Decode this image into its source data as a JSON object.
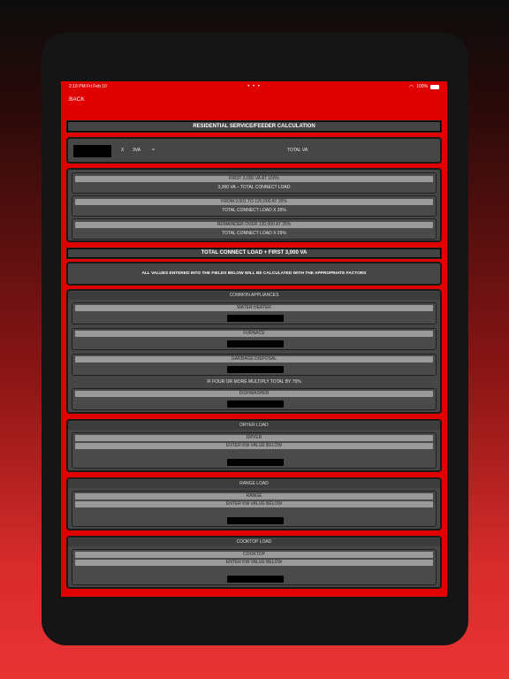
{
  "status": {
    "time": "2:19 PM   Fri Feb 10",
    "dots": "• • •",
    "battery": "100%"
  },
  "nav": {
    "back": "BACK"
  },
  "calc": {
    "title": "RESIDENTIAL SERVICE/FEEDER CALCULATION",
    "x": "X",
    "factor": "3VA",
    "equals": "=",
    "total_va": "TOTAL VA"
  },
  "tiers": {
    "t1_label": "FIRST 3,000 VA AT 100%",
    "t1_value": "3,000 VA – TOTAL CONNECT LOAD",
    "t2_label": "FROM 3,001 TO 120,000 AT 35%",
    "t2_value": "TOTAL CONNECT LOAD X 35%",
    "t3_label": "REMAINDER OVER 120,000 AT 25%",
    "t3_value": "TOTAL CONNECT LOAD X 25%"
  },
  "total_bar": "TOTAL CONNECT LOAD + FIRST 3,000 VA",
  "notice": "ALL VALUES ENTERED INTO THE FIELDS BELOW WILL BE CALCULATED WITH THE APPROPRIATE FACTORS",
  "appliances": {
    "header": "COMMON APPLIANCES",
    "water_heater": "WATER HEATER",
    "furnace": "FURNACE",
    "garbage_disposal": "GARBAGE DISPOSAL",
    "note": "IF FOUR OR MORE MULTIPLY TOTAL BY 75%",
    "dishwasher": "DISHWASHER"
  },
  "dryer": {
    "header": "DRYER LOAD",
    "label": "DRYER",
    "hint": "ENTER KW VALUE BELOW"
  },
  "range": {
    "header": "RANGE LOAD",
    "label": "RANGE",
    "hint": "ENTER KW VALUE BELOW"
  },
  "cooktop": {
    "header": "COOKTOP LOAD",
    "label": "COOKTOP",
    "hint": "ENTER KW VALUE BELOW"
  }
}
